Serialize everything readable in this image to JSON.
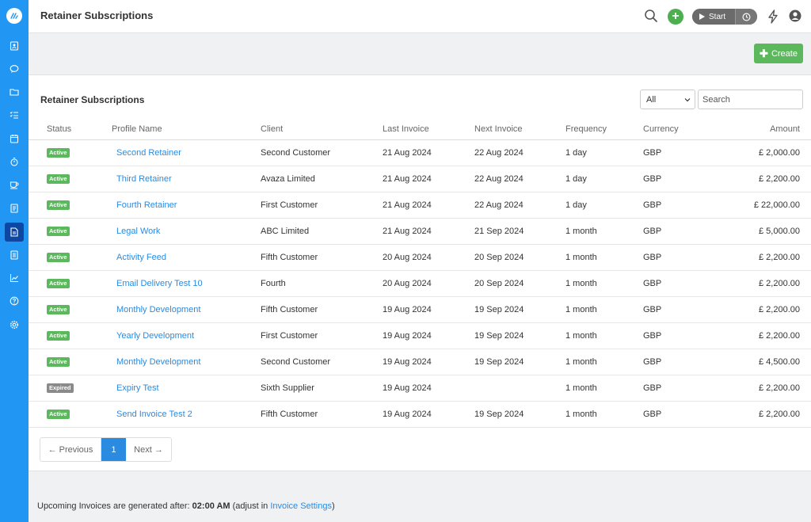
{
  "sidebar": {
    "icons": [
      "logo-icon",
      "contacts-icon",
      "chat-icon",
      "folder-icon",
      "tasks-icon",
      "calendar-icon",
      "timer-icon",
      "coffee-icon",
      "invoice-icon",
      "subscriptions-icon",
      "document-icon",
      "reports-icon",
      "help-icon",
      "settings-icon"
    ]
  },
  "header": {
    "title": "Retainer Subscriptions",
    "start_label": "Start"
  },
  "toolbar": {
    "create_label": "Create"
  },
  "panel": {
    "title": "Retainer Subscriptions",
    "filter_value": "All",
    "search_placeholder": "Search"
  },
  "table": {
    "columns": [
      "Status",
      "Profile Name",
      "Client",
      "Last Invoice",
      "Next Invoice",
      "Frequency",
      "Currency",
      "Amount"
    ],
    "rows": [
      {
        "status": "Active",
        "profile": "Second Retainer",
        "client": "Second Customer",
        "last": "21 Aug 2024",
        "next": "22 Aug 2024",
        "freq": "1 day",
        "curr": "GBP",
        "amount": "£ 2,000.00"
      },
      {
        "status": "Active",
        "profile": "Third Retainer",
        "client": "Avaza Limited",
        "last": "21 Aug 2024",
        "next": "22 Aug 2024",
        "freq": "1 day",
        "curr": "GBP",
        "amount": "£ 2,200.00"
      },
      {
        "status": "Active",
        "profile": "Fourth Retainer",
        "client": "First Customer",
        "last": "21 Aug 2024",
        "next": "22 Aug 2024",
        "freq": "1 day",
        "curr": "GBP",
        "amount": "£ 22,000.00"
      },
      {
        "status": "Active",
        "profile": "Legal Work",
        "client": "ABC Limited",
        "last": "21 Aug 2024",
        "next": "21 Sep 2024",
        "freq": "1 month",
        "curr": "GBP",
        "amount": "£ 5,000.00"
      },
      {
        "status": "Active",
        "profile": "Activity Feed",
        "client": "Fifth Customer",
        "last": "20 Aug 2024",
        "next": "20 Sep 2024",
        "freq": "1 month",
        "curr": "GBP",
        "amount": "£ 2,200.00"
      },
      {
        "status": "Active",
        "profile": "Email Delivery Test 10",
        "client": "Fourth",
        "last": "20 Aug 2024",
        "next": "20 Sep 2024",
        "freq": "1 month",
        "curr": "GBP",
        "amount": "£ 2,200.00"
      },
      {
        "status": "Active",
        "profile": "Monthly Development",
        "client": "Fifth Customer",
        "last": "19 Aug 2024",
        "next": "19 Sep 2024",
        "freq": "1 month",
        "curr": "GBP",
        "amount": "£ 2,200.00"
      },
      {
        "status": "Active",
        "profile": "Yearly Development",
        "client": "First Customer",
        "last": "19 Aug 2024",
        "next": "19 Sep 2024",
        "freq": "1 month",
        "curr": "GBP",
        "amount": "£ 2,200.00"
      },
      {
        "status": "Active",
        "profile": "Monthly Development",
        "client": "Second Customer",
        "last": "19 Aug 2024",
        "next": "19 Sep 2024",
        "freq": "1 month",
        "curr": "GBP",
        "amount": "£ 4,500.00"
      },
      {
        "status": "Expired",
        "profile": "Expiry Test",
        "client": "Sixth Supplier",
        "last": "19 Aug 2024",
        "next": "",
        "freq": "1 month",
        "curr": "GBP",
        "amount": "£ 2,200.00"
      },
      {
        "status": "Active",
        "profile": "Send Invoice Test 2",
        "client": "Fifth Customer",
        "last": "19 Aug 2024",
        "next": "19 Sep 2024",
        "freq": "1 month",
        "curr": "GBP",
        "amount": "£ 2,200.00"
      }
    ]
  },
  "pagination": {
    "prev_label": "← Previous",
    "page": "1",
    "next_label": "Next →"
  },
  "footer": {
    "prefix": "Upcoming Invoices are generated after: ",
    "time": "02:00 AM",
    "middle": " (adjust in ",
    "link": "Invoice Settings",
    "suffix": ")"
  },
  "colors": {
    "sidebar": "#2196f3",
    "accent_link": "#2a8be0",
    "create_button": "#5cb85c",
    "active_badge": "#5cb85c",
    "expired_badge": "#8a8a8a"
  }
}
